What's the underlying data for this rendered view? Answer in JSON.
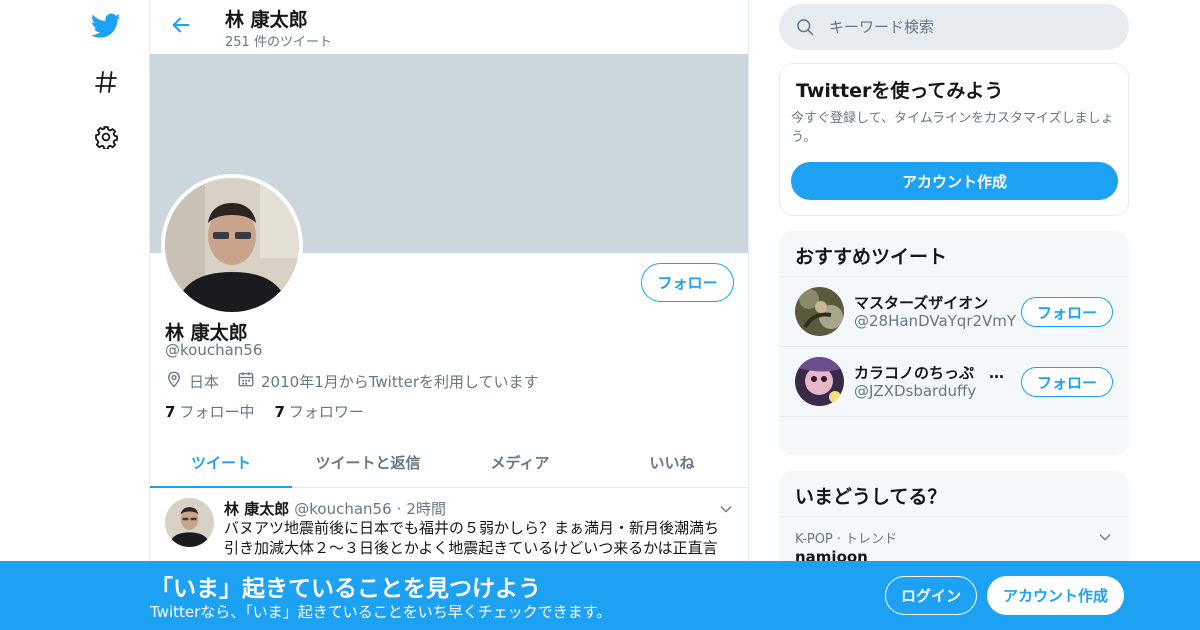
{
  "nav": {
    "icons": [
      "twitter-bird-icon",
      "hashtag-icon",
      "gear-icon"
    ]
  },
  "header": {
    "title": "林 康太郎",
    "tweet_count": "251 件のツイート"
  },
  "profile": {
    "name": "林 康太郎",
    "handle": "@kouchan56",
    "location": "日本",
    "joined": "2010年1月からTwitterを利用しています",
    "following_count": "7",
    "following_label": "フォロー中",
    "followers_count": "7",
    "followers_label": "フォロワー",
    "follow_label": "フォロー"
  },
  "tabs": [
    {
      "label": "ツイート",
      "active": true
    },
    {
      "label": "ツイートと返信",
      "active": false
    },
    {
      "label": "メディア",
      "active": false
    },
    {
      "label": "いいね",
      "active": false
    }
  ],
  "tweet": {
    "name": "林 康太郎",
    "handle": "@kouchan56",
    "separator": "·",
    "time": "2時間",
    "text": "バヌアツ地震前後に日本でも福井の５弱かしら？まぁ満月・新月後潮満ち引き加減大体２〜３日後とかよく地震起きているけどいつ来るかは正直言"
  },
  "search": {
    "placeholder": "キーワード検索"
  },
  "signup_card": {
    "title": "Twitterを使ってみよう",
    "description": "今すぐ登録して、タイムラインをカスタマイズしましょう。",
    "button": "アカウント作成"
  },
  "recommend": {
    "title": "おすすめツイート",
    "users": [
      {
        "name": "マスターズザイオン",
        "handle": "@28HanDVaYqr2VmY",
        "follow": "フォロー"
      },
      {
        "name": "カラコノのちっぷ　…",
        "handle": "@JZXDsbarduffy",
        "follow": "フォロー"
      }
    ]
  },
  "trends": {
    "title": "いまどうしてる？",
    "items": [
      {
        "meta": "K-POP · トレンド",
        "name": "namjoon"
      }
    ]
  },
  "bottom_bar": {
    "title": "「いま」起きていることを見つけよう",
    "subtitle": "Twitterなら、「いま」起きていることをいち早くチェックできます。",
    "login": "ログイン",
    "signup": "アカウント作成"
  },
  "colors": {
    "accent": "#1da1f2",
    "banner": "#ccd6dd",
    "muted": "#657786"
  }
}
